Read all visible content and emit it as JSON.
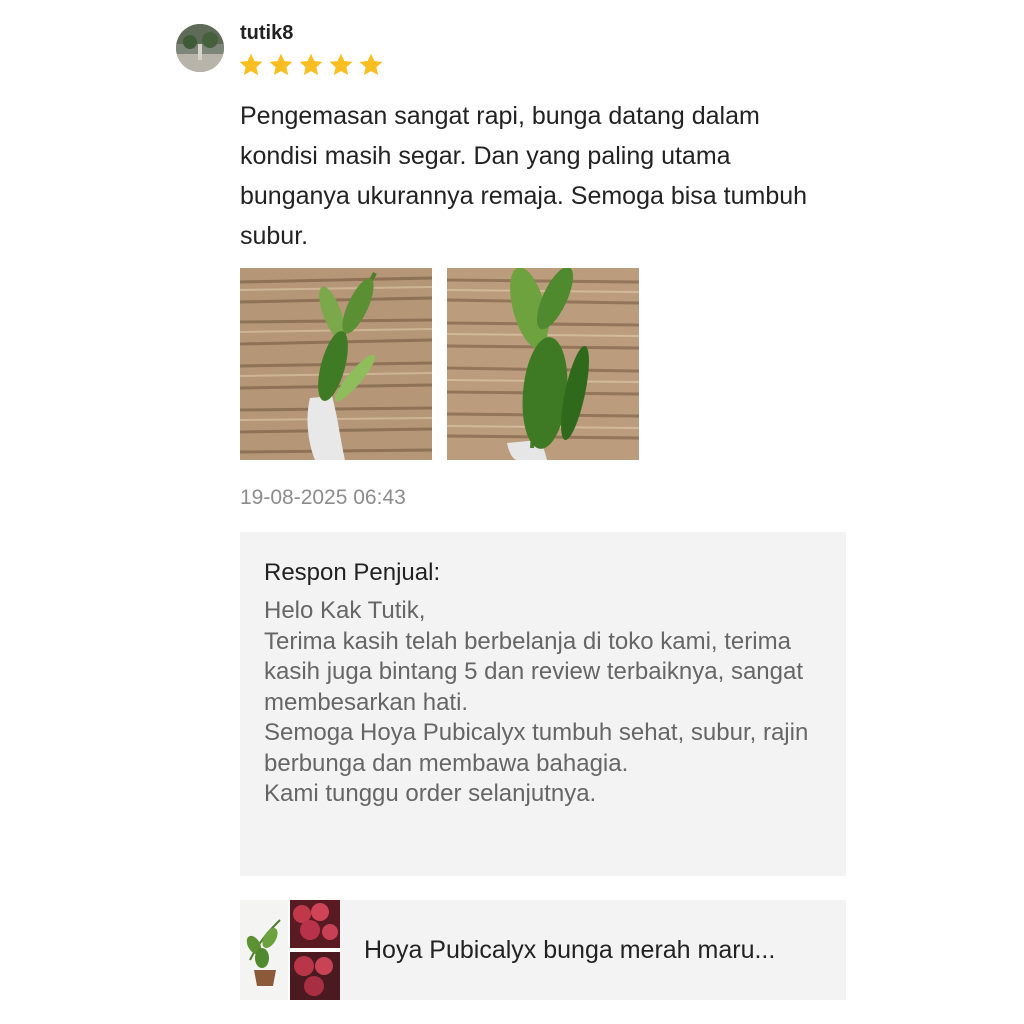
{
  "review": {
    "username": "tutik8",
    "rating": 5,
    "text": "Pengemasan sangat rapi, bunga datang dalam kondisi masih segar. Dan yang paling utama bunganya ukurannya remaja. Semoga bisa tumbuh subur.",
    "photos": [
      "review-photo-1",
      "review-photo-2"
    ],
    "timestamp": "19-08-2025 06:43"
  },
  "seller_response": {
    "title": "Respon Penjual:",
    "body": "Helo Kak Tutik,\nTerima kasih telah berbelanja di toko kami, terima kasih juga bintang 5 dan review terbaiknya, sangat membesarkan hati.\nSemoga Hoya Pubicalyx tumbuh sehat, subur, rajin berbunga dan membawa bahagia.\nKami tunggu order selanjutnya."
  },
  "product": {
    "name": "Hoya Pubicalyx bunga merah maru..."
  },
  "colors": {
    "star": "#f9bf22",
    "timestamp": "#8c8c8c",
    "response_bg": "#f3f3f3",
    "response_text": "#666666"
  },
  "icons": [
    "star-icon"
  ]
}
